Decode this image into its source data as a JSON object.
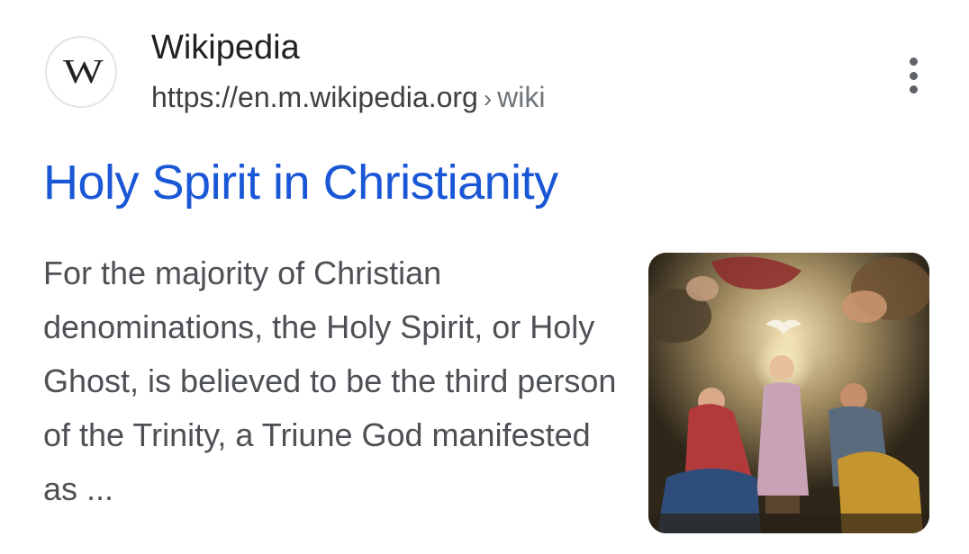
{
  "result": {
    "favicon_letter": "W",
    "site_name": "Wikipedia",
    "url": {
      "domain": "https://en.m.wikipedia.org",
      "separator": "›",
      "path": "wiki"
    },
    "menu_icon": "more-vertical-icon",
    "title": "Holy Spirit in Christianity",
    "snippet": "For the majority of Christian denominations, the Holy Spirit, or Holy Ghost, is believed to be the third person of the Trinity, a Triune God manifested as ...",
    "thumbnail_icon": "painting-thumbnail",
    "colors": {
      "title_link": "#1a57d6",
      "snippet_text": "#4d5156",
      "site_name": "#202124"
    }
  }
}
